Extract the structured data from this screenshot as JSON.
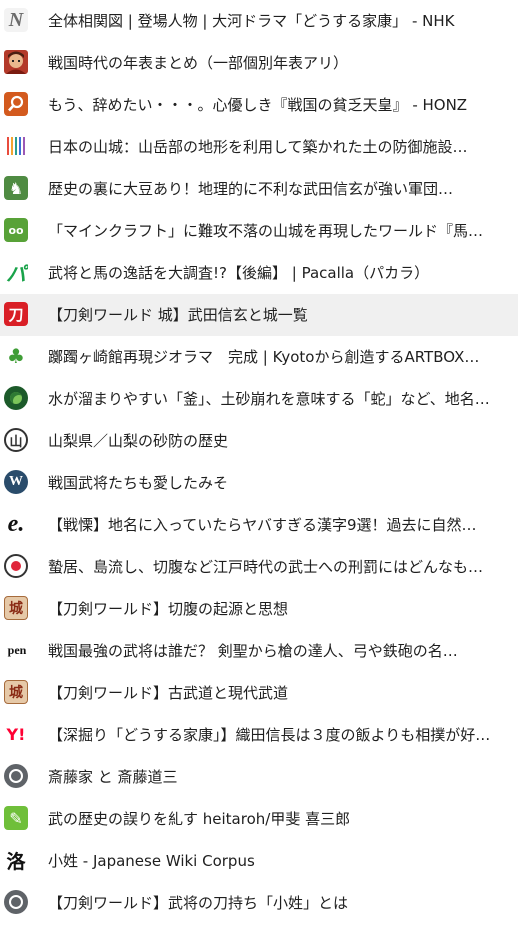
{
  "history": {
    "items": [
      {
        "title": "全体相関図 | 登場人物 | 大河ドラマ「どうする家康」 - NHK",
        "icon": "nhk-icon",
        "glyph": "N"
      },
      {
        "title": "戦国時代の年表まとめ（一部個別年表アリ）",
        "icon": "portrait-icon",
        "glyph": ""
      },
      {
        "title": "もう、辞めたい・・・。心優しき『戦国の貧乏天皇』 - HONZ",
        "icon": "magnifier-icon",
        "glyph": "⌕"
      },
      {
        "title": "日本の山城：山岳部の地形を利用して築かれた土の防御施設…",
        "icon": "color-bars-icon",
        "glyph": ""
      },
      {
        "title": "歴史の裏に大豆あり！地理的に不利な武田信玄が強い軍団…",
        "icon": "camel-icon",
        "glyph": "♞"
      },
      {
        "title": "「マインクラフト」に難攻不落の山城を再現したワールド『馬城』…",
        "icon": "minecraft-icon",
        "glyph": "oo"
      },
      {
        "title": "武将と馬の逸話を大調査!?【後編】 | Pacalla（パカラ）",
        "icon": "pacalla-icon",
        "glyph": "パ"
      },
      {
        "title": "【刀剣ワールド 城】武田信玄と城一覧",
        "icon": "touken-icon",
        "glyph": "刀"
      },
      {
        "title": "躑躅ヶ崎館再現ジオラマ　完成 | Kyotoから創造するARTBOX…",
        "icon": "owl-icon",
        "glyph": "♣"
      },
      {
        "title": "水が溜まりやすい「釜」、土砂崩れを意味する「蛇」など、地名…",
        "icon": "swirl-icon",
        "glyph": ""
      },
      {
        "title": "山梨県／山梨の砂防の歴史",
        "icon": "crest-icon",
        "glyph": "山"
      },
      {
        "title": "戦国武将たちも愛したみそ",
        "icon": "wordpress-icon",
        "glyph": "W"
      },
      {
        "title": "【戦慄】地名に入っていたらヤバすぎる漢字9選！過去に自然…",
        "icon": "excite-icon",
        "glyph": "e."
      },
      {
        "title": "蟄居、島流し、切腹など江戸時代の武士への刑罰にはどんなも…",
        "icon": "target-icon",
        "glyph": ""
      },
      {
        "title": "【刀剣ワールド】切腹の起源と思想",
        "icon": "touken-castle-icon",
        "glyph": "城"
      },
      {
        "title": "戦国最強の武将は誰だ？ 剣聖から槍の達人、弓や鉄砲の名…",
        "icon": "pen-icon",
        "glyph": "pen"
      },
      {
        "title": "【刀剣ワールド】古武道と現代武道",
        "icon": "touken-castle-icon",
        "glyph": "城"
      },
      {
        "title": "【深掘り「どうする家康」】織田信長は３度の飯よりも相撲が好…",
        "icon": "yahoo-icon",
        "glyph": "Y!"
      },
      {
        "title": "斎藤家 と 斎藤道三",
        "icon": "globe-icon",
        "glyph": ""
      },
      {
        "title": "武の歴史の誤りを糺す heitaroh/甲斐 喜三郎",
        "icon": "leaf-icon",
        "glyph": "✎"
      },
      {
        "title": "小姓 - Japanese Wiki Corpus",
        "icon": "kanji-icon",
        "glyph": "洛"
      },
      {
        "title": "【刀剣ワールド】武将の刀持ち「小姓」とは",
        "icon": "globe-icon",
        "glyph": ""
      }
    ]
  }
}
